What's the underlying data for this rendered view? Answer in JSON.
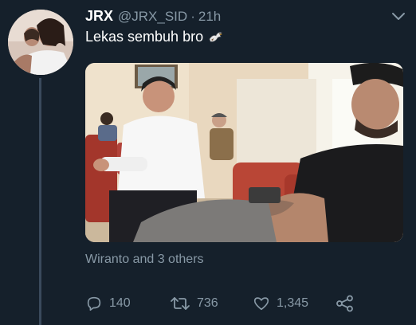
{
  "tweet": {
    "display_name": "JRX",
    "handle": "@JRX_SID",
    "separator": "·",
    "time": "21h",
    "text": "Lekas sembuh bro",
    "emoji": "eagle-emoji",
    "tagged_people": "Wiranto and 3 others"
  },
  "actions": {
    "reply_count": "140",
    "retweet_count": "736",
    "like_count": "1,345"
  },
  "icons": {
    "reply": "reply-icon",
    "retweet": "retweet-icon",
    "like": "heart-icon",
    "share": "share-icon",
    "menu": "chevron-down-icon"
  },
  "colors": {
    "background": "#15202b",
    "text_primary": "#ffffff",
    "text_secondary": "#8899a6"
  }
}
